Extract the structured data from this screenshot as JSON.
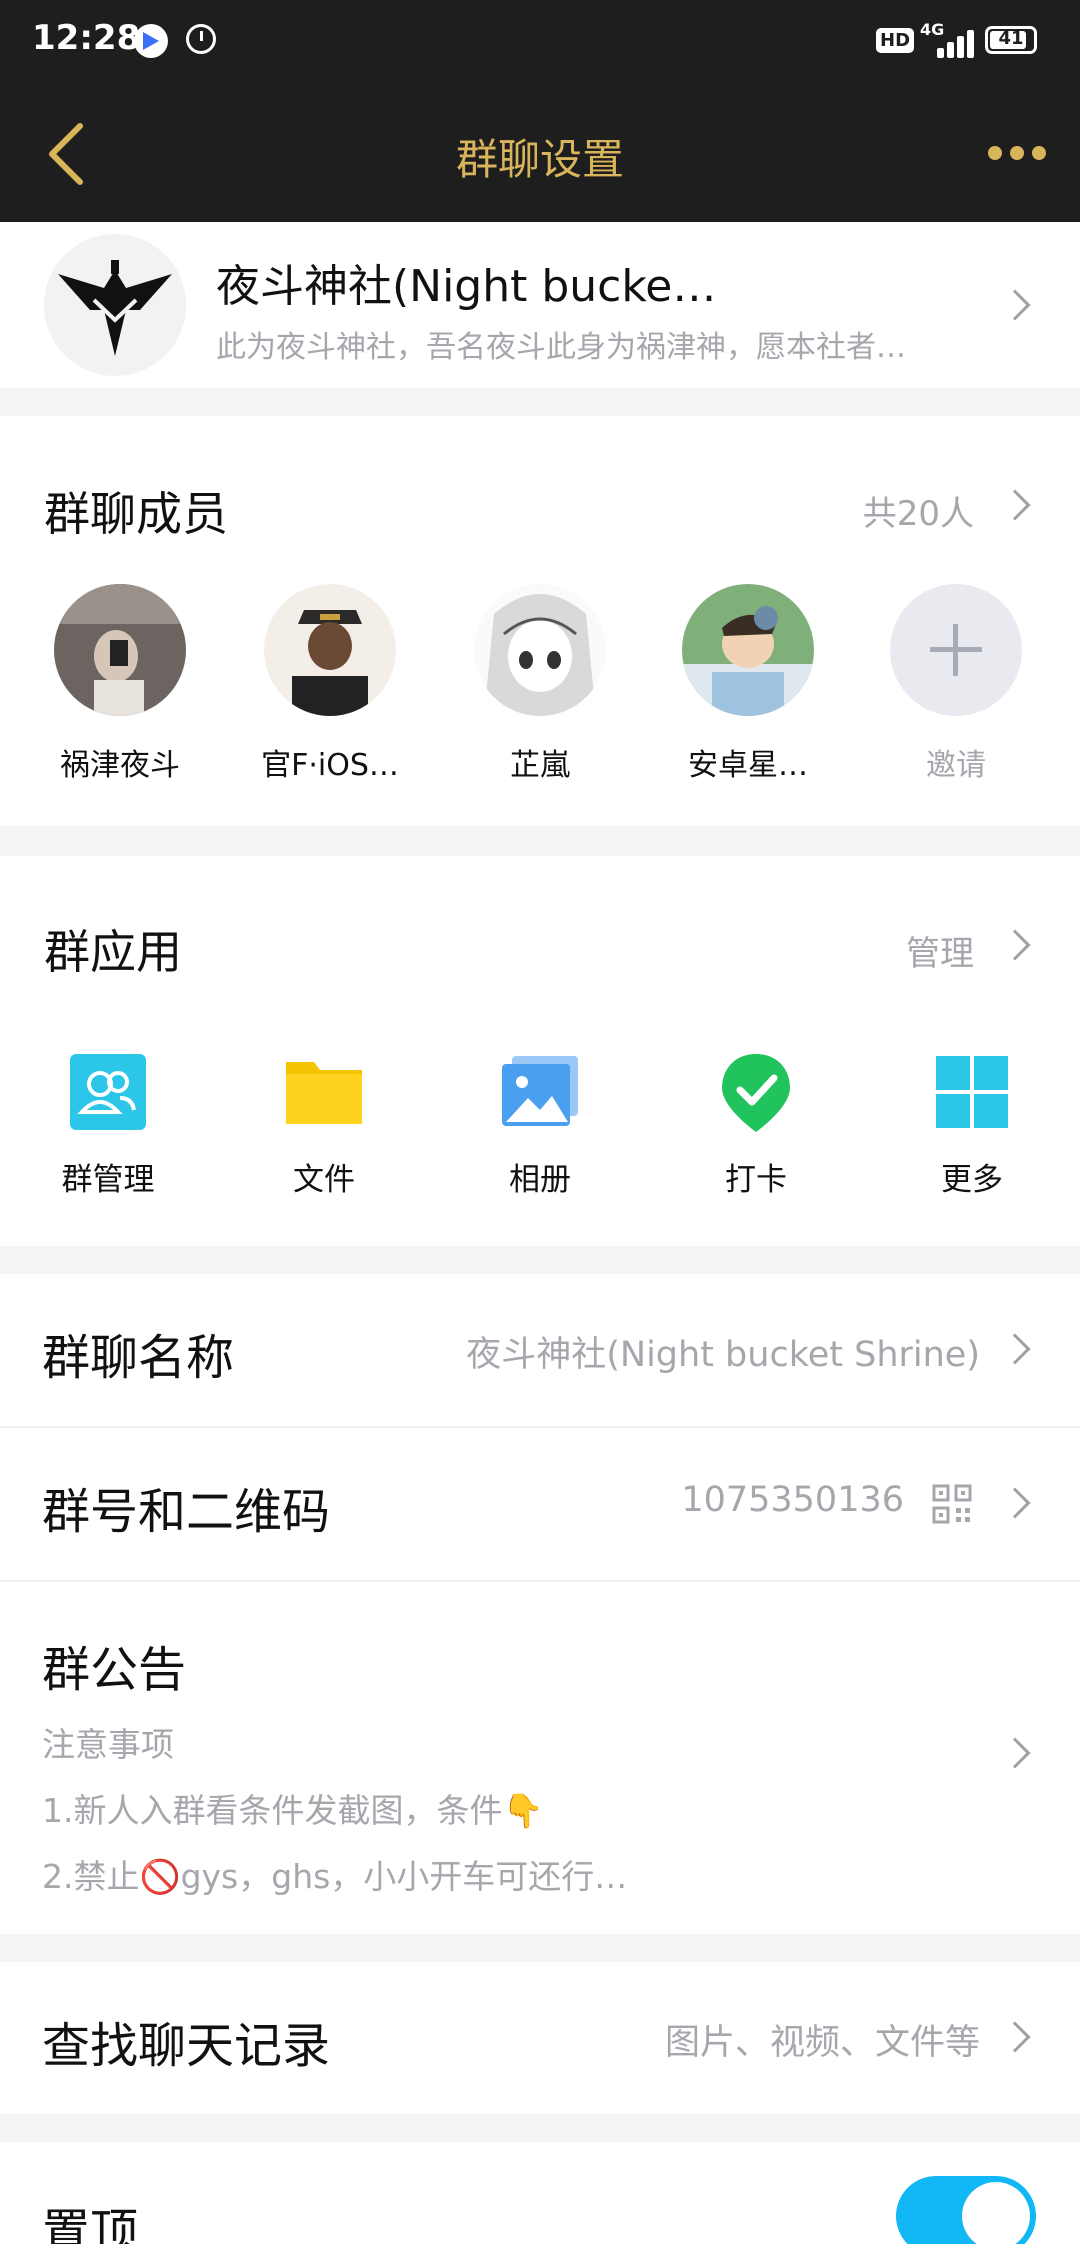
{
  "status_bar": {
    "time": "12:28",
    "network": "4G",
    "hd": "HD",
    "battery": "41"
  },
  "navbar": {
    "title": "群聊设置"
  },
  "group": {
    "name": "夜斗神社(Night  bucke…",
    "description": "此为夜斗神社，吾名夜斗此身为祸津神，愿本社者…"
  },
  "members": {
    "title": "群聊成员",
    "count_label": "共20人",
    "items": [
      {
        "name": "祸津夜斗"
      },
      {
        "name": "官F·iOS…"
      },
      {
        "name": "芷嵐"
      },
      {
        "name": "安卓星…"
      }
    ],
    "invite_label": "邀请"
  },
  "apps": {
    "title": "群应用",
    "manage_label": "管理",
    "items": [
      {
        "label": "群管理",
        "icon": "group-manage-icon"
      },
      {
        "label": "文件",
        "icon": "folder-icon"
      },
      {
        "label": "相册",
        "icon": "album-icon"
      },
      {
        "label": "打卡",
        "icon": "check-in-icon"
      },
      {
        "label": "更多",
        "icon": "grid-more-icon"
      }
    ]
  },
  "group_name_row": {
    "label": "群聊名称",
    "value": "夜斗神社(Night  bucket  Shrine)"
  },
  "group_number_row": {
    "label": "群号和二维码",
    "value": "1075350136"
  },
  "announcement": {
    "label": "群公告",
    "line1": "注意事项",
    "line2": "1.新人入群看条件发截图，条件👇",
    "line3": "2.禁止🚫gys，ghs，小小开车可还行…"
  },
  "search_history": {
    "label": "查找聊天记录",
    "value": "图片、视频、文件等"
  },
  "pin_top": {
    "label": "置顶",
    "enabled": true
  },
  "colors": {
    "accent_gold": "#d8b45a",
    "toggle_blue": "#12b7f5",
    "header_bg": "#1e1e1e"
  }
}
